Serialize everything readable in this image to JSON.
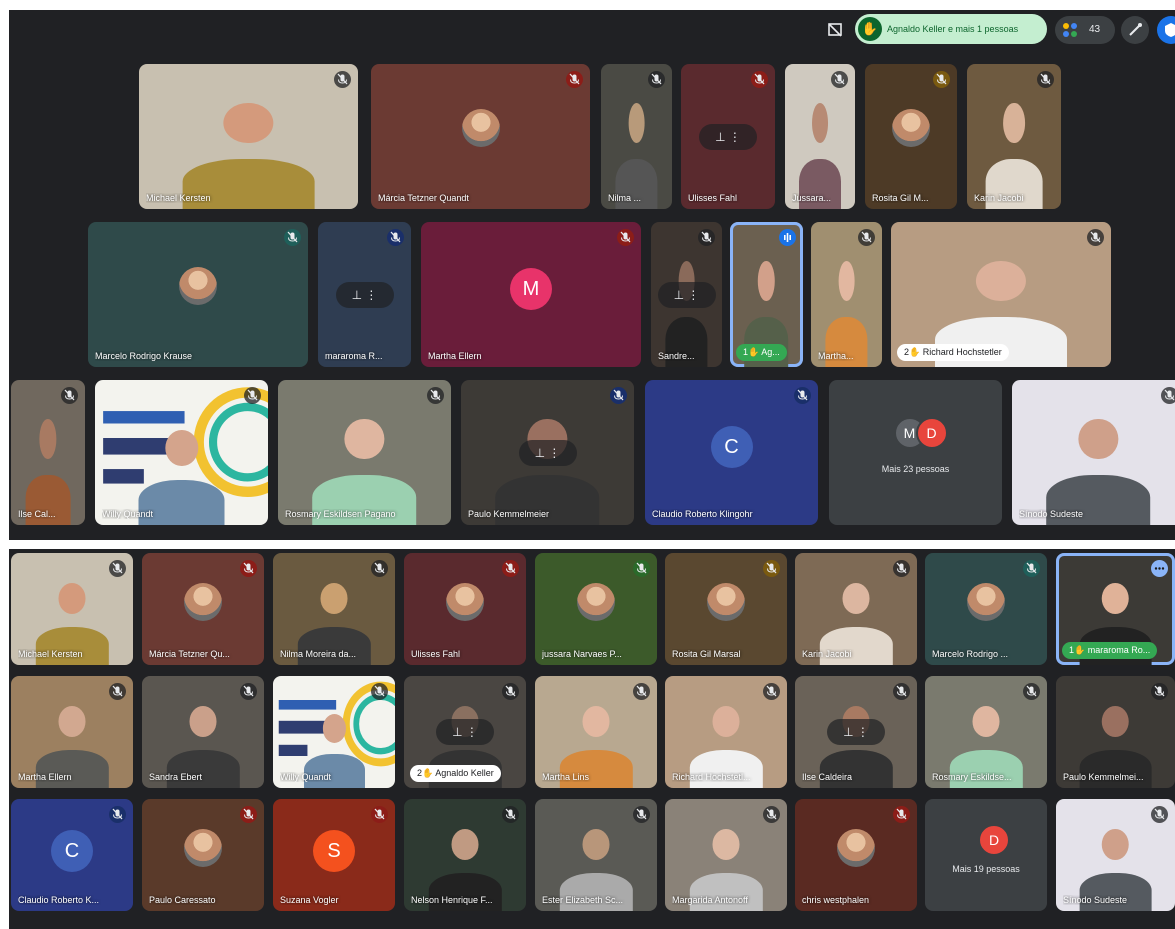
{
  "colors": {
    "meet_bg": "#202124",
    "speaking_border": "#8ab4f8",
    "hand_raise_bg": "#c4eed0"
  },
  "screenshot_top": {
    "toolbar": {
      "hand_raise_text": "Agnaldo Keller e mais 1 pessoas",
      "participants_count": "43"
    },
    "tiles": [
      {
        "name": "Michael Kersten"
      },
      {
        "name": "Márcia Tetzner Quandt"
      },
      {
        "name": "Nilma ..."
      },
      {
        "name": "Ulisses Fahl"
      },
      {
        "name": "Jussara..."
      },
      {
        "name": "Rosita Gil M..."
      },
      {
        "name": "Karin Jacobi"
      },
      {
        "name": "Marcelo Rodrigo Krause"
      },
      {
        "name": "mararoma R..."
      },
      {
        "name": "Martha Ellern",
        "initial": "M"
      },
      {
        "name": "Sandre..."
      },
      {
        "name": "Ag...",
        "badge": "1"
      },
      {
        "name": "Martha..."
      },
      {
        "name": "Richard Hochstetler",
        "badge": "2"
      },
      {
        "name": "Ilse Cal..."
      },
      {
        "name": "Willy Quandt"
      },
      {
        "name": "Rosmary Eskildsen Pagano"
      },
      {
        "name": "Paulo Kemmelmeier"
      },
      {
        "name": "Claudio Roberto Klingohr",
        "initial": "C"
      },
      {
        "name": "Mais 23 pessoas",
        "initials": [
          "M",
          "D"
        ]
      },
      {
        "name": "Sínodo Sudeste"
      }
    ]
  },
  "screenshot_bottom": {
    "tiles": [
      {
        "name": "Michael Kersten"
      },
      {
        "name": "Márcia Tetzner Qu..."
      },
      {
        "name": "Nilma Moreira da..."
      },
      {
        "name": "Ulisses Fahl"
      },
      {
        "name": "jussara Narvaes P..."
      },
      {
        "name": "Rosita Gil Marsal"
      },
      {
        "name": "Karin Jacobi"
      },
      {
        "name": "Marcelo Rodrigo ..."
      },
      {
        "name": "mararoma Ro...",
        "badge": "1"
      },
      {
        "name": "Martha Ellern"
      },
      {
        "name": "Sandra Ebert"
      },
      {
        "name": "Willy Quandt"
      },
      {
        "name": "Agnaldo Keller",
        "badge": "2"
      },
      {
        "name": "Martha Lins"
      },
      {
        "name": "Richard Hochstetl..."
      },
      {
        "name": "Ilse Caldeira"
      },
      {
        "name": "Rosmary Eskildse..."
      },
      {
        "name": "Paulo Kemmelmei..."
      },
      {
        "name": "Claudio Roberto K...",
        "initial": "C"
      },
      {
        "name": "Paulo Caressato"
      },
      {
        "name": "Suzana Vogler",
        "initial": "S"
      },
      {
        "name": "Nelson Henrique F..."
      },
      {
        "name": "Ester Elizabeth Sc..."
      },
      {
        "name": "Margarida Antonoff"
      },
      {
        "name": "chris westphalen"
      },
      {
        "name": "Mais 19 pessoas",
        "initials": [
          "D"
        ]
      },
      {
        "name": "Sínodo Sudeste"
      }
    ]
  }
}
